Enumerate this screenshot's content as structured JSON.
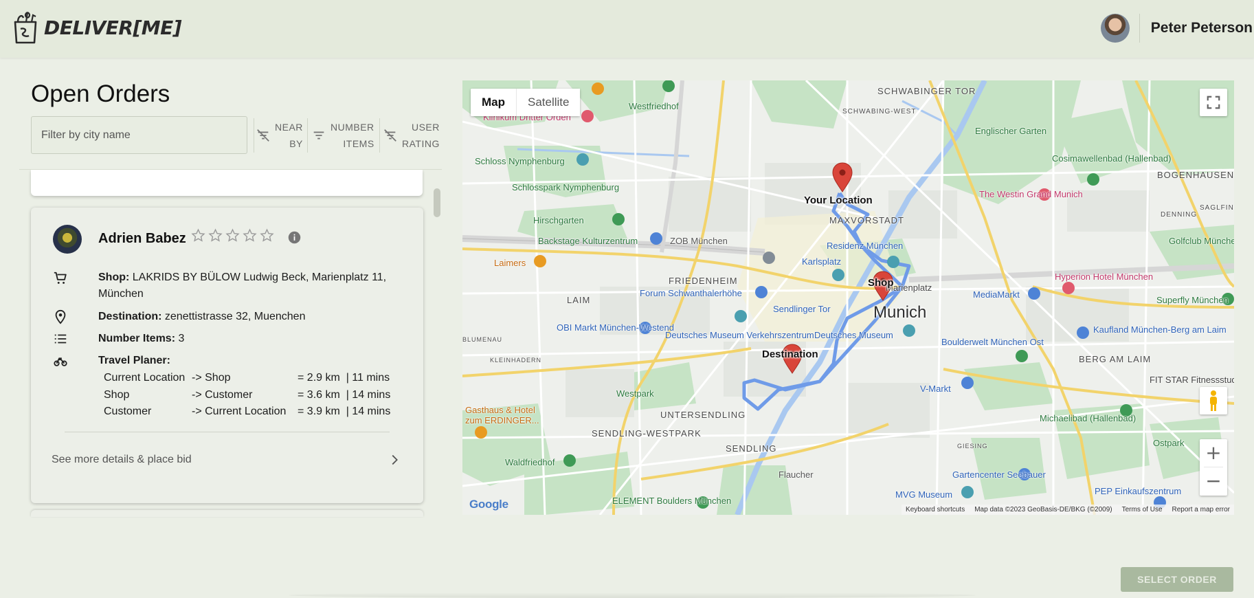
{
  "app": {
    "logo_text": "DELIVER[ME]"
  },
  "user": {
    "name": "Peter Peterson"
  },
  "page": {
    "title": "Open Orders"
  },
  "filter": {
    "placeholder": "Filter by city name"
  },
  "sort_buttons": [
    {
      "line1": "NEAR",
      "line2": "BY"
    },
    {
      "line1": "NUMBER",
      "line2": "ITEMS"
    },
    {
      "line1": "USER",
      "line2": "RATING"
    }
  ],
  "order": {
    "customer_name": "Adrien Babez",
    "rating_stars": 0,
    "rating_max": 5,
    "shop_label": "Shop:",
    "shop_value": "LAKRIDS BY BÜLOW Ludwig Beck, Marienplatz 11, München",
    "destination_label": "Destination:",
    "destination_value": "zenettistrasse 32, Muenchen",
    "items_label": "Number Items:",
    "items_value": "3",
    "travel_label": "Travel Planer:",
    "travel_rows": [
      {
        "from": "Current Location",
        "to": "-> Shop",
        "dist": "= 2.9 km  | 11 mins"
      },
      {
        "from": "Shop",
        "to": "-> Customer",
        "dist": "= 3.6 km  | 14 mins"
      },
      {
        "from": "Customer",
        "to": "-> Current Location",
        "dist": "= 3.9 km  | 14 mins"
      }
    ],
    "details_link": "See more details & place bid"
  },
  "map": {
    "type_map": "Map",
    "type_satellite": "Satellite",
    "markers": {
      "you": "Your Location",
      "shop": "Shop",
      "destination": "Destination"
    },
    "city": "Munich",
    "areas": [
      "SCHWABINGER TOR",
      "SCHWABING-WEST",
      "MAXVORSTADT",
      "FRIEDENHEIM",
      "LAIM",
      "BOGENHAUSEN",
      "BERG AM LAIM",
      "UNTERSENDLING",
      "SENDLING-WESTPARK",
      "SENDLING",
      "DENNING",
      "SAGLFING",
      "BLUMENAU",
      "KLEINHADERN",
      "GIESING"
    ],
    "pois": [
      "Klinikum Dritter Orden",
      "Westfriedhof",
      "Schloss Nymphenburg",
      "Schlosspark Nymphenburg",
      "Hirschgarten",
      "Backstage Kulturzentrum",
      "ZOB München",
      "Laimers",
      "Residenz München",
      "Karlsplatz",
      "Marienplatz",
      "Forum Schwanthalerhöhe",
      "Sendlinger Tor",
      "OBI Markt München-Westend",
      "Deutsches Museum Verkehrszentrum",
      "Deutsches Museum",
      "Englischer Garten",
      "Cosimawellenbad (Hallenbad)",
      "The Westin Grand Munich",
      "Golfclub München",
      "Hyperion Hotel München",
      "MediaMarkt",
      "Superfly München",
      "Kaufland München-Berg am Laim",
      "Boulderwelt München Ost",
      "FIT STAR Fitnessstudio München-Truderin",
      "V-Markt",
      "Michaelibad (Hallenbad)",
      "Ostpark",
      "Westpark",
      "Gasthaus & Hotel zum ERDINGER...",
      "Waldfriedhof",
      "Flaucher",
      "Gartencenter Seebauer",
      "MVG Museum",
      "ELEMENT Boulders München",
      "PEP Einkaufszentrum"
    ],
    "google": "Google",
    "attribution": [
      "Keyboard shortcuts",
      "Map data ©2023 GeoBasis-DE/BKG (©2009)",
      "Terms of Use",
      "Report a map error"
    ]
  },
  "actions": {
    "select_order": "SELECT ORDER"
  },
  "colors": {
    "accent": "#a9b99f",
    "route": "#6f9be8",
    "marker": "#d9453a"
  }
}
